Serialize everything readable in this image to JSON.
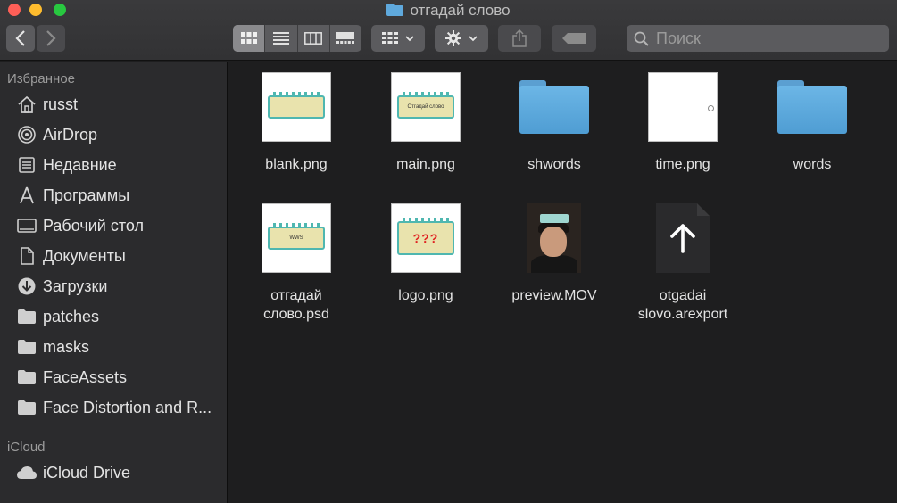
{
  "window": {
    "title": "отгадай слово"
  },
  "toolbar": {
    "back_label": "‹",
    "forward_label": "›",
    "search_placeholder": "Поиск"
  },
  "sidebar": {
    "favorites_header": "Избранное",
    "favorites": [
      {
        "label": "russt",
        "icon": "home-icon"
      },
      {
        "label": "AirDrop",
        "icon": "airdrop-icon"
      },
      {
        "label": "Недавние",
        "icon": "recents-icon"
      },
      {
        "label": "Программы",
        "icon": "applications-icon"
      },
      {
        "label": "Рабочий стол",
        "icon": "desktop-icon"
      },
      {
        "label": "Документы",
        "icon": "documents-icon"
      },
      {
        "label": "Загрузки",
        "icon": "downloads-icon"
      },
      {
        "label": "patches",
        "icon": "folder-icon"
      },
      {
        "label": "masks",
        "icon": "folder-icon"
      },
      {
        "label": "FaceAssets",
        "icon": "folder-icon"
      },
      {
        "label": "Face Distortion and R...",
        "icon": "folder-icon"
      }
    ],
    "icloud_header": "iCloud",
    "icloud": [
      {
        "label": "iCloud Drive",
        "icon": "cloud-icon"
      }
    ]
  },
  "files": [
    {
      "name": "blank.png",
      "kind": "png"
    },
    {
      "name": "main.png",
      "kind": "png",
      "thumb_text": "Отгадай слово"
    },
    {
      "name": "shwords",
      "kind": "folder"
    },
    {
      "name": "time.png",
      "kind": "png-blank"
    },
    {
      "name": "words",
      "kind": "folder"
    },
    {
      "name": "отгадай слово.psd",
      "kind": "psd",
      "thumb_text": "WWS"
    },
    {
      "name": "logo.png",
      "kind": "png",
      "thumb_text": "???"
    },
    {
      "name": "preview.MOV",
      "kind": "video"
    },
    {
      "name": "otgadai slovo.arexport",
      "kind": "arexport"
    }
  ],
  "colors": {
    "accent_folder": "#5fa9dd",
    "close": "#fe5f57",
    "minimize": "#febc2e",
    "maximize": "#28c840"
  }
}
